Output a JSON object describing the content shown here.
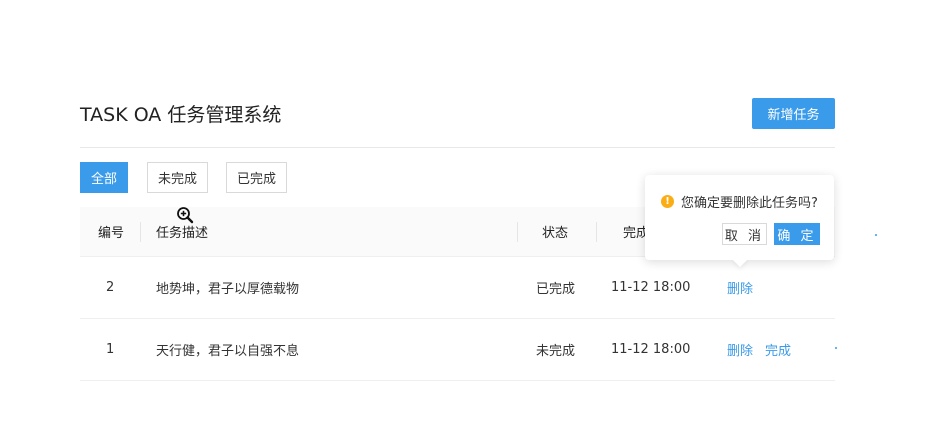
{
  "header": {
    "title": "TASK OA 任务管理系统",
    "add_button": "新增任务"
  },
  "filters": [
    {
      "label": "全部",
      "active": true
    },
    {
      "label": "未完成",
      "active": false
    },
    {
      "label": "已完成",
      "active": false
    }
  ],
  "table": {
    "columns": [
      "编号",
      "任务描述",
      "状态",
      "完成"
    ],
    "rows": [
      {
        "id": "2",
        "desc": "地势坤，君子以厚德载物",
        "status": "已完成",
        "time": "11-12 18:00",
        "actions": [
          "删除"
        ]
      },
      {
        "id": "1",
        "desc": "天行健，君子以自强不息",
        "status": "未完成",
        "time": "11-12 18:00",
        "actions": [
          "删除",
          "完成"
        ]
      }
    ]
  },
  "popconfirm": {
    "message": "您确定要删除此任务吗?",
    "cancel": "取 消",
    "ok": "确 定"
  },
  "colors": {
    "primary": "#3a9bea",
    "warning": "#faad14",
    "border": "#d9d9d9"
  },
  "icons": {
    "warning": "exclamation-circle-icon",
    "cursor": "zoom-in-cursor-icon"
  }
}
